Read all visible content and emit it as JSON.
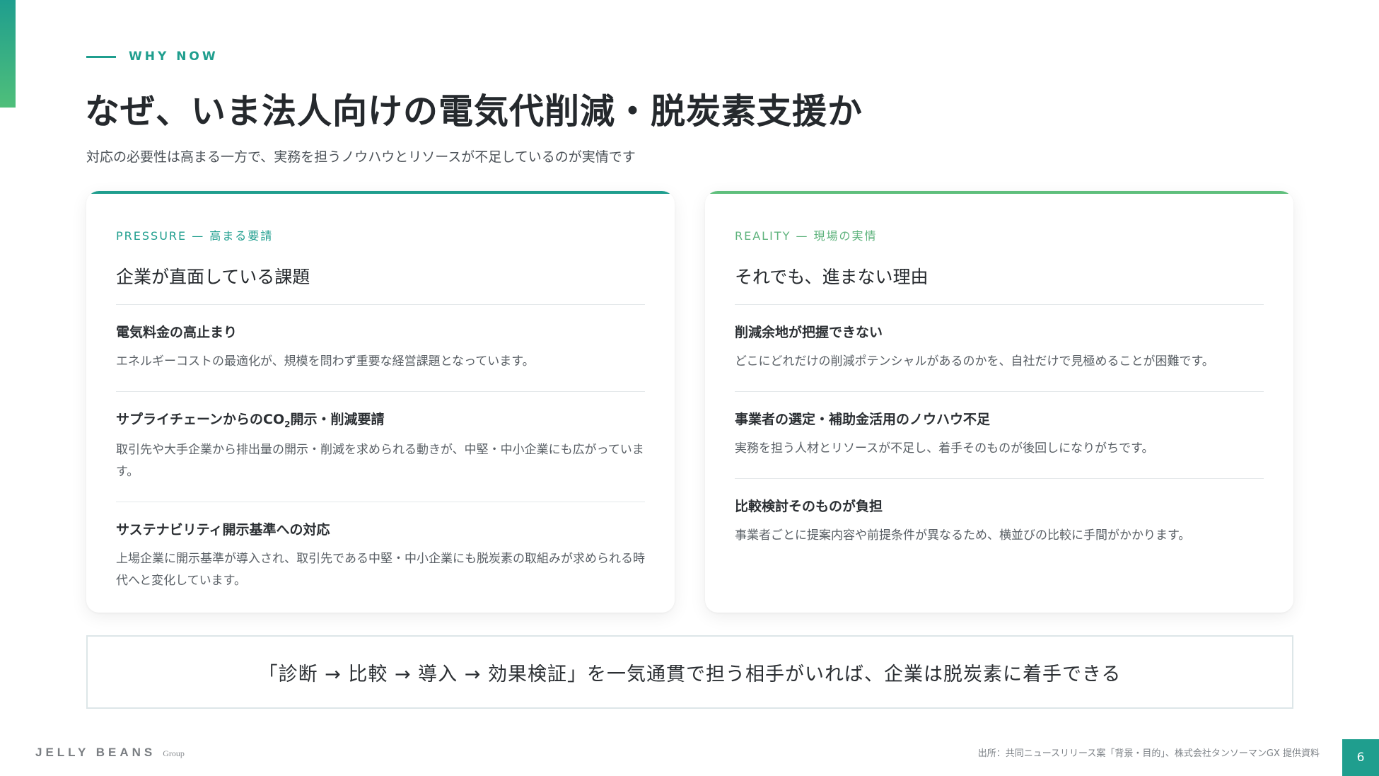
{
  "eyebrow": "WHY NOW",
  "title": "なぜ、いま法人向けの電気代削減・脱炭素支援か",
  "subtitle": "対応の必要性は高まる一方で、実務を担うノウハウとリソースが不足しているのが実情です",
  "left_card": {
    "label": "PRESSURE — 高まる要請",
    "heading": "企業が直面している課題",
    "items": [
      {
        "title": "電気料金の高止まり",
        "desc": "エネルギーコストの最適化が、規模を問わず重要な経営課題となっています。"
      },
      {
        "title_pre": "サプライチェーンからのCO",
        "title_sub": "2",
        "title_post": "開示・削減要請",
        "desc": "取引先や大手企業から排出量の開示・削減を求められる動きが、中堅・中小企業にも広がっています。"
      },
      {
        "title": "サステナビリティ開示基準への対応",
        "desc": "上場企業に開示基準が導入され、取引先である中堅・中小企業にも脱炭素の取組みが求められる時代へと変化しています。"
      }
    ]
  },
  "right_card": {
    "label": "REALITY — 現場の実情",
    "heading": "それでも、進まない理由",
    "items": [
      {
        "title": "削減余地が把握できない",
        "desc": "どこにどれだけの削減ポテンシャルがあるのかを、自社だけで見極めることが困難です。"
      },
      {
        "title": "事業者の選定・補助金活用のノウハウ不足",
        "desc": "実務を担う人材とリソースが不足し、着手そのものが後回しになりがちです。"
      },
      {
        "title": "比較検討そのものが負担",
        "desc": "事業者ごとに提案内容や前提条件が異なるため、横並びの比較に手間がかかります。"
      }
    ]
  },
  "banner": "「診断 → 比較 → 導入 → 効果検証」を一気通貫で担う相手がいれば、企業は脱炭素に着手できる",
  "footer": {
    "logo_main": "JELLY BEANS",
    "logo_sub": "Group",
    "source": "出所：共同ニュースリリース案「背景・目的」、株式会社タンソーマンGX 提供資料",
    "page_number": "6"
  },
  "colors": {
    "teal": "#1f9e8e",
    "green": "#5fbf7c"
  }
}
